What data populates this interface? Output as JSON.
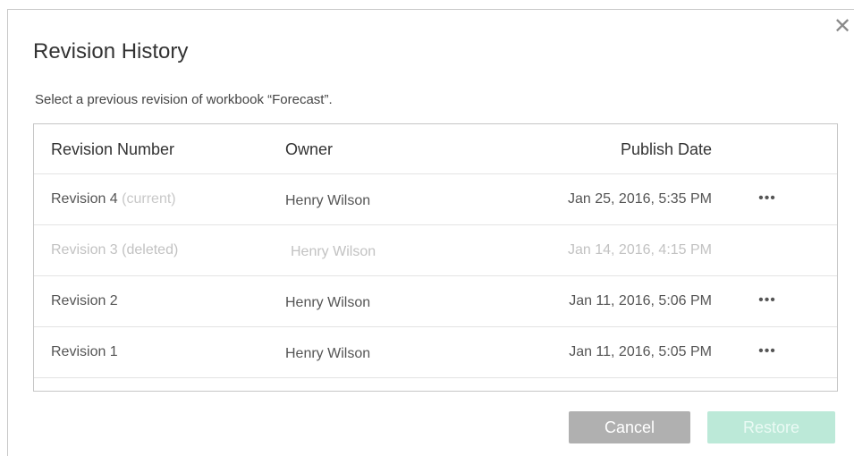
{
  "dialog": {
    "title": "Revision History",
    "subtitle": "Select a previous revision of workbook “Forecast”.",
    "close_icon": "✕"
  },
  "table": {
    "headers": {
      "revision": "Revision Number",
      "owner": "Owner",
      "date": "Publish Date"
    },
    "rows": [
      {
        "revision": "Revision 4",
        "tag": "(current)",
        "owner": "Henry Wilson",
        "date": "Jan 25, 2016, 5:35 PM",
        "menu": "•••"
      },
      {
        "revision": "Revision 3 (deleted)",
        "owner": "Henry Wilson",
        "date": "Jan 14, 2016, 4:15 PM"
      },
      {
        "revision": "Revision 2",
        "owner": "Henry Wilson",
        "date": "Jan 11, 2016, 5:06 PM",
        "menu": "•••"
      },
      {
        "revision": "Revision 1",
        "owner": "Henry Wilson",
        "date": "Jan 11, 2016, 5:05 PM",
        "menu": "•••"
      }
    ]
  },
  "buttons": {
    "cancel": "Cancel",
    "restore": "Restore"
  },
  "colors": {
    "cancel_bg": "#b0b0b0",
    "restore_bg": "#bce9d8",
    "deleted_text": "#c2c2c2"
  }
}
